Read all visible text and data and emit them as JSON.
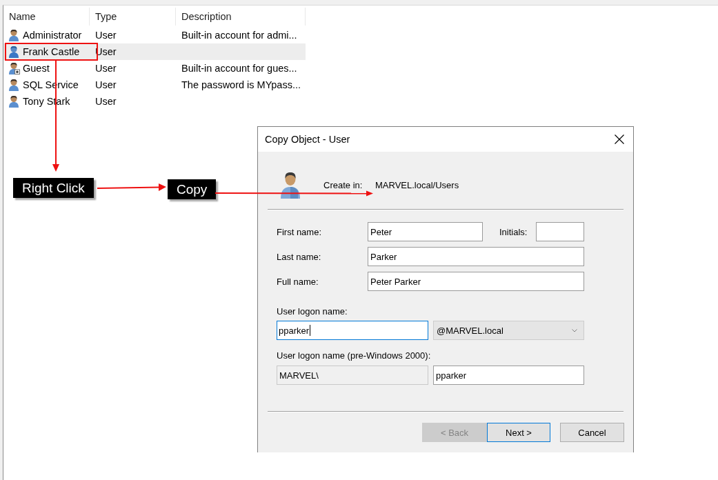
{
  "user_list": {
    "columns": [
      "Name",
      "Type",
      "Description"
    ],
    "rows": [
      {
        "name": "Administrator",
        "type": "User",
        "description": "Built-in account for admi...",
        "selected": false,
        "disabled": false
      },
      {
        "name": "Frank Castle",
        "type": "User",
        "selected": true,
        "disabled": false
      },
      {
        "name": "Guest",
        "type": "User",
        "description": "Built-in account for gues...",
        "selected": false,
        "disabled": true
      },
      {
        "name": "SQL Service",
        "type": "User",
        "description": "The password is MYpass...",
        "selected": false,
        "disabled": false
      },
      {
        "name": "Tony Stark",
        "type": "User",
        "selected": false,
        "disabled": false
      }
    ]
  },
  "callouts": [
    {
      "text": "Right Click"
    },
    {
      "text": "Copy"
    }
  ],
  "dialog": {
    "title": "Copy Object - User",
    "create_in": {
      "label": "Create in:",
      "value": "MARVEL.local/Users"
    },
    "first_name": {
      "label": "First name:",
      "value": "Peter"
    },
    "initials": {
      "label": "Initials:"
    },
    "last_name": {
      "label": "Last name:",
      "value": "Parker"
    },
    "full_name": {
      "label": "Full name:",
      "value": "Peter Parker"
    },
    "logon_name": {
      "label": "User logon name:",
      "value": "pparker",
      "focused": true,
      "domain": "@MARVEL.local"
    },
    "pre_windows_2000": {
      "label": "User logon name (pre-Windows 2000):",
      "domain": "MARVEL\\",
      "value": "pparker"
    },
    "buttons": [
      {
        "label": "< Back",
        "disabled": true,
        "default": false
      },
      {
        "label": "Next >",
        "disabled": false,
        "default": true
      },
      {
        "label": "Cancel",
        "disabled": false,
        "default": false
      }
    ]
  }
}
